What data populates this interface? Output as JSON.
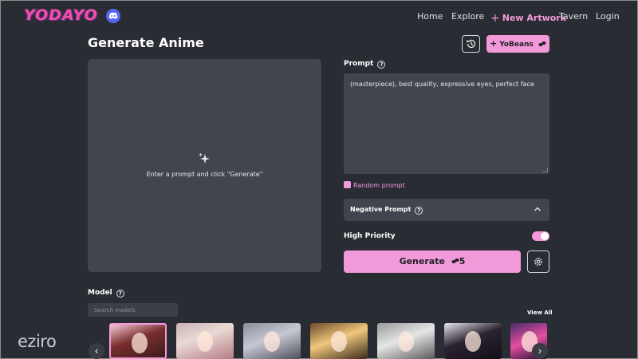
{
  "brand": {
    "logo": "YODAYO",
    "discord_icon": "discord-icon"
  },
  "nav": {
    "home": "Home",
    "explore": "Explore",
    "new_artwork": "New Artwork",
    "tavern": "Tavern",
    "login": "Login"
  },
  "header": {
    "title": "Generate Anime",
    "history_icon": "history-icon",
    "yobeans_label": "YoBeans"
  },
  "preview": {
    "hint": "Enter a prompt and click \"Generate\""
  },
  "prompt": {
    "label": "Prompt",
    "value": "(masterpiece), best quality, expressive eyes, perfect face",
    "random_label": "Random prompt"
  },
  "negative_prompt": {
    "label": "Negative Prompt",
    "expanded": false
  },
  "high_priority": {
    "label": "High Priority",
    "enabled": true
  },
  "generate": {
    "label": "Generate",
    "cost": "5"
  },
  "model": {
    "label": "Model",
    "search_placeholder": "Search models",
    "view_all": "View All",
    "selected_index": 0
  },
  "watermark": "eziro",
  "colors": {
    "accent": "#f29ad9",
    "background": "#2a2c33",
    "panel": "#42454d"
  }
}
